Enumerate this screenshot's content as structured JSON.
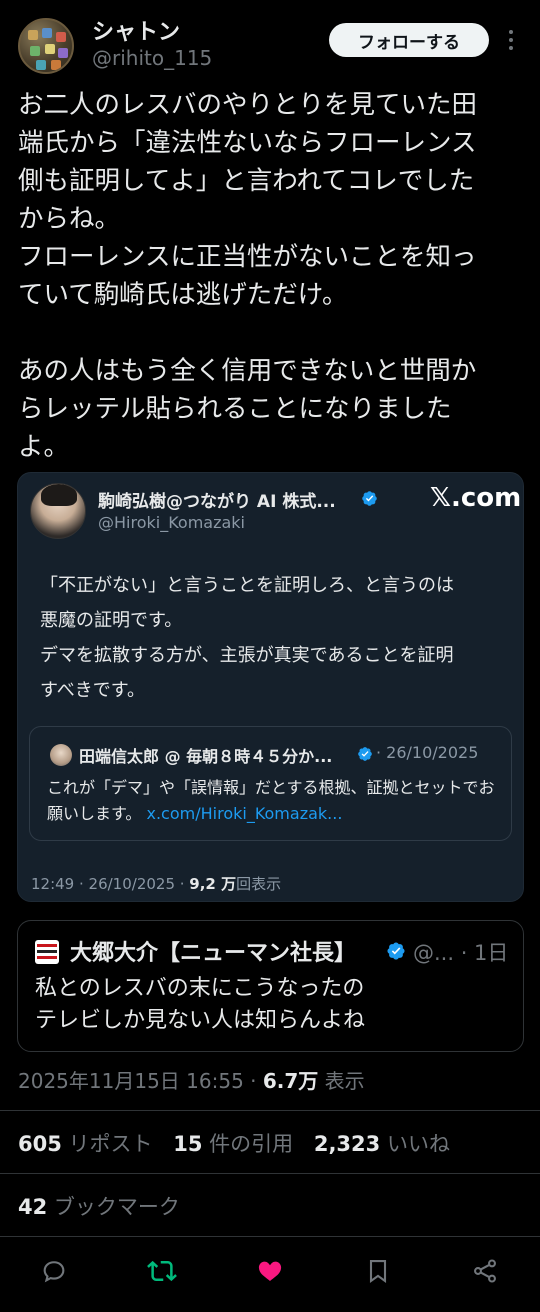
{
  "author": {
    "name": "シャトン",
    "handle": "@rihito_115",
    "follow_label": "フォローする"
  },
  "tweet": {
    "text": "お二人のレスバのやりとりを見ていた田\n端氏から「違法性ないならフローレンス\n側も証明してよ」と言われてコレでした\nからね。\nフローレンスに正当性がないことを知っ\nていて駒崎氏は逃げただけ。\n\nあの人はもう全く信用できないと世間か\nらレッテル貼られることになりました\nよ。"
  },
  "quoted": {
    "name": "駒崎弘樹@つながり AI 株式...",
    "handle": "@Hiroki_Komazaki",
    "brand": "𝕏.com",
    "text": "「不正がない」と言うことを証明しろ、と言うのは\n悪魔の証明です。\nデマを拡散する方が、主張が真実であることを証明\nすべきです。",
    "inner": {
      "name": "田端信太郎 @ 毎朝８時４５分か...",
      "date": "· 26/10/2025",
      "text": "これが「デマ」や「誤情報」だとする根拠、証拠とセットでお願いします。",
      "link": "x.com/Hiroki_Komazak..."
    },
    "meta_time": "12:49 · 26/10/2025 · ",
    "meta_views": "9,2 万",
    "meta_views_suffix": "回表示"
  },
  "sub_quote": {
    "name": "大郷大介【ニューマン社長】",
    "handle": "@... · 1日",
    "text": "私とのレスバの末にこうなったの\nテレビしか見ない人は知らんよね"
  },
  "timestamp": {
    "time": "2025年11月15日 16:55 · ",
    "views": "6.7万",
    "views_label": " 表示"
  },
  "stats": {
    "reposts_count": "605",
    "reposts_label": " リポスト",
    "quotes_count": "15",
    "quotes_label": " 件の引用",
    "likes_count": "2,323",
    "likes_label": " いいね",
    "bookmarks_count": "42",
    "bookmarks_label": " ブックマーク"
  },
  "actions": {
    "icons": [
      "reply-icon",
      "retweet-icon",
      "like-icon",
      "bookmark-icon",
      "share-icon"
    ],
    "colors": {
      "retweet": "#00ba7c",
      "like": "#f91880",
      "default": "#71767b",
      "verified": "#1d9bf0"
    }
  }
}
